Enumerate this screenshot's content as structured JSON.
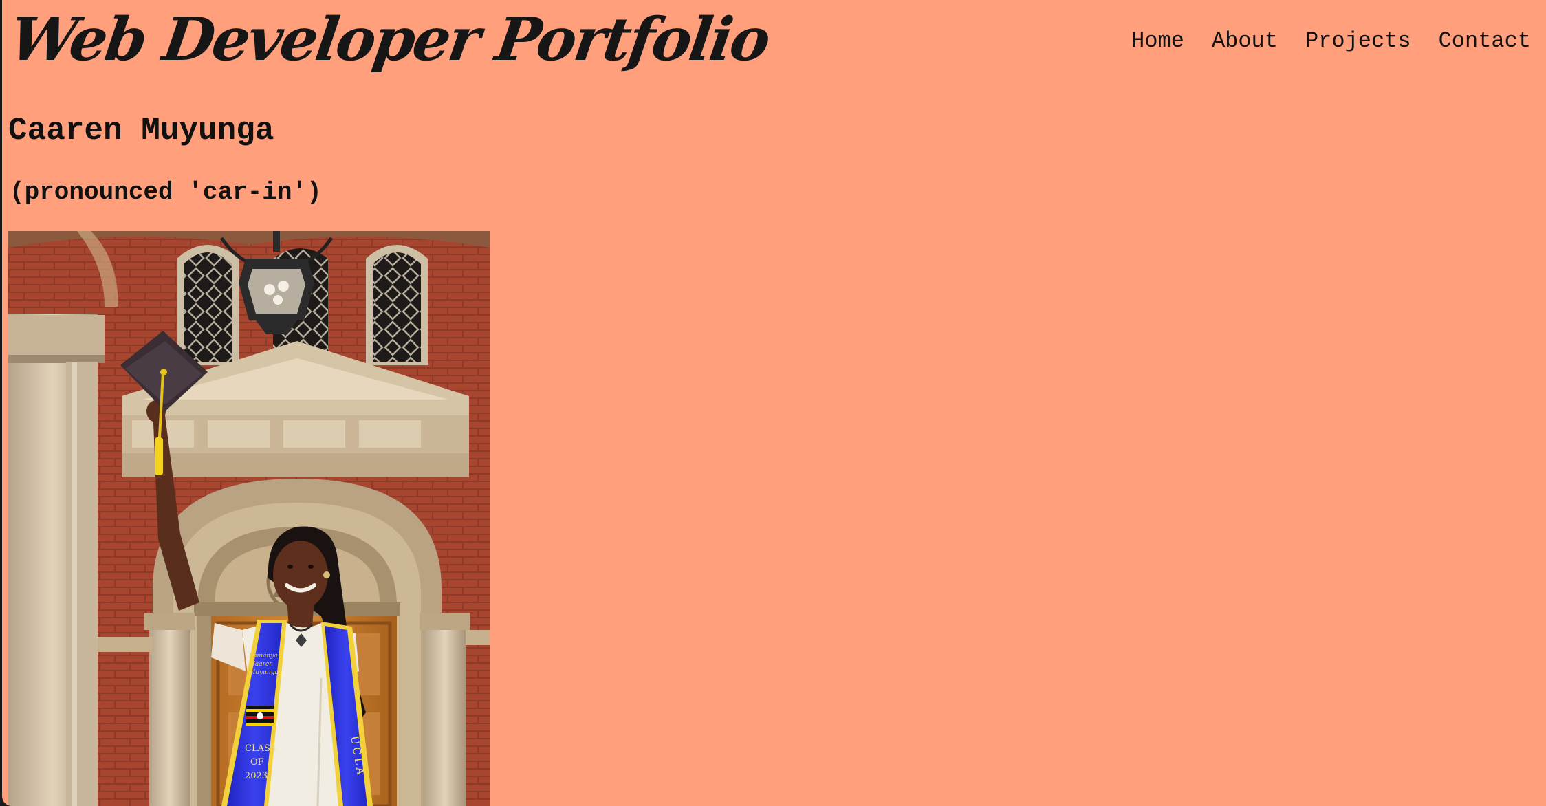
{
  "site": {
    "title": "Web Developer Portfolio"
  },
  "nav": {
    "items": [
      {
        "label": "Home"
      },
      {
        "label": "About"
      },
      {
        "label": "Projects"
      },
      {
        "label": "Contact"
      }
    ]
  },
  "main": {
    "name": "Caaren Muyunga",
    "pronunciation": "(pronounced 'car-in')",
    "photo": {
      "stole_text_left": [
        "CLASS",
        "OF",
        "2023"
      ],
      "stole_text_right": "UCLA"
    }
  },
  "colors": {
    "page_background": "#ff9f7c",
    "text": "#111111",
    "stole_blue": "#2a2fd6",
    "stole_trim": "#f2d13a",
    "brick": "#a8452f"
  }
}
